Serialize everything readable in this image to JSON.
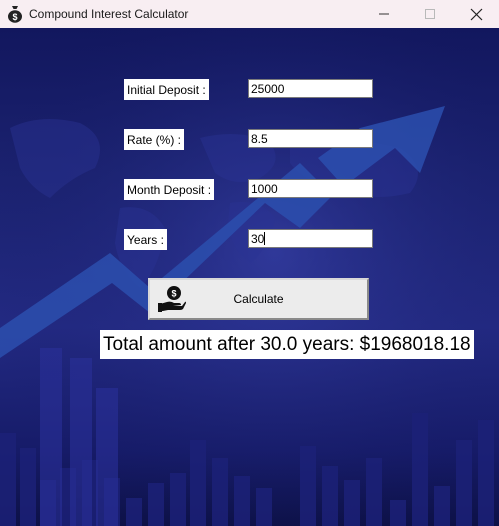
{
  "window": {
    "title": "Compound Interest Calculator",
    "app_icon": "money-bag-icon",
    "controls": [
      "minimize-icon",
      "maximize-icon",
      "close-icon"
    ]
  },
  "form": {
    "initial_deposit": {
      "label": "Initial Deposit :",
      "value": "25000"
    },
    "rate": {
      "label": "Rate (%) :",
      "value": "8.5"
    },
    "month_deposit": {
      "label": "Month Deposit :",
      "value": "1000"
    },
    "years": {
      "label": "Years :",
      "value": "30"
    }
  },
  "calculate_button": {
    "label": "Calculate",
    "icon": "hand-holding-money-icon"
  },
  "result": {
    "text": "Total amount after 30.0 years: $1968018.18"
  },
  "colors": {
    "background_top": "#12175e",
    "background_mid": "#232a83",
    "arrow": "#2f56b8",
    "titlebar": "#f8eef2"
  }
}
